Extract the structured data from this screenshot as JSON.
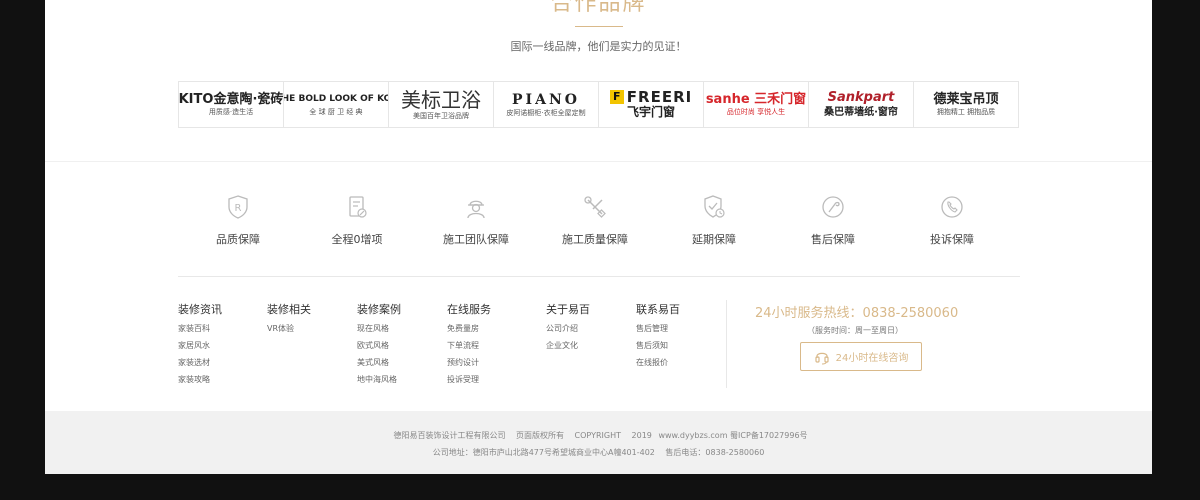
{
  "partners": {
    "title": "合作品牌",
    "subtitle": "国际一线品牌，他们是实力的见证！",
    "brands": [
      {
        "main": "KITO金意陶·瓷砖",
        "sub": "用质感·造生活"
      },
      {
        "main": "科勒 THE BOLD LOOK OF KOHLER",
        "sub": "全 球 厨 卫 经 典"
      },
      {
        "main": "美标卫浴",
        "sub": "美国百年卫浴品牌"
      },
      {
        "main": "PIANO",
        "sub": "皮阿诺橱柜·衣柜全屋定制"
      },
      {
        "main": "FREERI",
        "sub": "飞宇门窗"
      },
      {
        "main": "sanhe 三禾门窗",
        "sub": "品位时尚 享悦人生"
      },
      {
        "main": "Sankpart",
        "sub": "桑巴蒂墙纸·窗帘"
      },
      {
        "main": "德莱宝吊顶",
        "sub": "拥抱精工 拥抱品质"
      }
    ]
  },
  "guarantees": [
    {
      "icon": "registered-shield-icon",
      "label": "品质保障"
    },
    {
      "icon": "document-check-icon",
      "label": "全程0增项"
    },
    {
      "icon": "worker-helmet-icon",
      "label": "施工团队保障"
    },
    {
      "icon": "tools-icon",
      "label": "施工质量保障"
    },
    {
      "icon": "shield-clock-icon",
      "label": "延期保障"
    },
    {
      "icon": "service-tool-icon",
      "label": "售后保障"
    },
    {
      "icon": "phone-icon",
      "label": "投诉保障"
    }
  ],
  "footer_nav": [
    {
      "heading": "装修资讯",
      "links": [
        "家装百科",
        "家居风水",
        "家装选材",
        "家装攻略"
      ]
    },
    {
      "heading": "装修相关",
      "links": [
        "VR体验"
      ]
    },
    {
      "heading": "装修案例",
      "links": [
        "现在风格",
        "欧式风格",
        "美式风格",
        "地中海风格"
      ]
    },
    {
      "heading": "在线服务",
      "links": [
        "免费量房",
        "下单流程",
        "预约设计",
        "投诉受理"
      ]
    },
    {
      "heading": "关于易百",
      "links": [
        "公司介绍",
        "企业文化"
      ]
    },
    {
      "heading": "联系易百",
      "links": [
        "售后管理",
        "售后须知",
        "在线报价"
      ]
    }
  ],
  "contact": {
    "hotline": "24小时服务热线：0838-2580060",
    "hours": "（服务时间：周一至周日）",
    "consult_label": "24小时在线咨询",
    "accent_color": "#d9b98a"
  },
  "copyright": {
    "company": "德阳易百装饰设计工程有限公司",
    "rights": "页面版权所有",
    "copyright_word": "COPYRIGHT",
    "year": "2019",
    "site": "www.dyybzs.com",
    "icp": "蜀ICP备17027996号",
    "address": "公司地址：德阳市庐山北路477号希望城商业中心A幢401-402",
    "phone": "售后电话：0838-2580060"
  }
}
